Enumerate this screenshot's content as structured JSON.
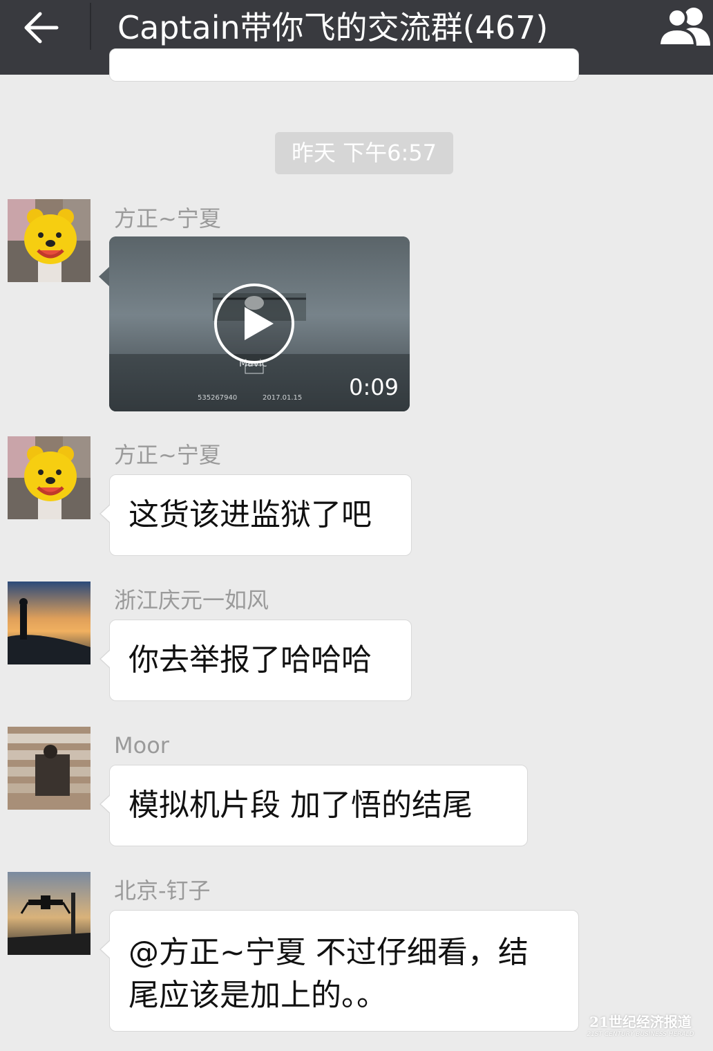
{
  "header": {
    "back_icon": "arrow-left-icon",
    "title": "Captain带你飞的交流群(467)",
    "group_icon": "group-members-icon"
  },
  "timestamp": "昨天 下午6:57",
  "messages": [
    {
      "sender": "方正~宁夏",
      "type": "video",
      "duration": "0:09",
      "video_brand": "Mavic",
      "video_id": "535267940",
      "video_date": "2017.01.15"
    },
    {
      "sender": "方正~宁夏",
      "type": "text",
      "text": "这货该进监狱了吧"
    },
    {
      "sender": "浙江庆元一如风",
      "type": "text",
      "text": "你去举报了哈哈哈"
    },
    {
      "sender": "Moor",
      "type": "text",
      "text": "模拟机片段  加了悟的结尾"
    },
    {
      "sender": "北京-钉子",
      "type": "text",
      "lines": [
        "@方正~宁夏 不过仔细看，结",
        "尾应该是加上的。。"
      ]
    }
  ],
  "watermark": {
    "cn": "21世纪经济报道",
    "en": "21ST CENTURY BUSINESS HERALD"
  },
  "colors": {
    "header_bg": "#393a3f",
    "chat_bg": "#ebebeb",
    "bubble_bg": "#ffffff",
    "sender_text": "#9a9a9a"
  }
}
